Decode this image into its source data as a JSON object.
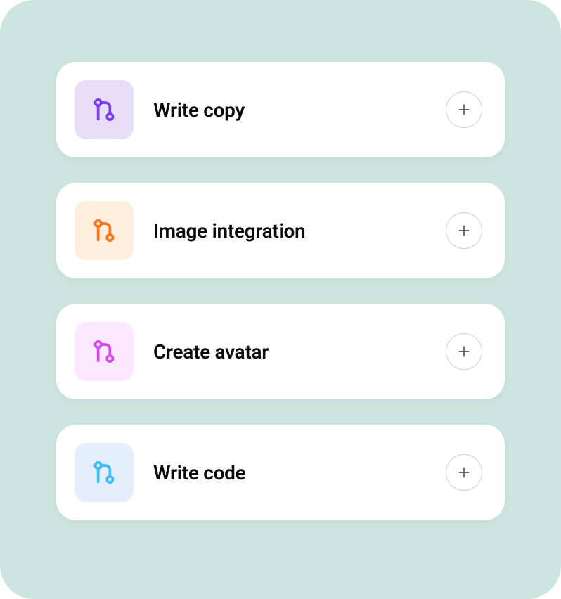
{
  "items": [
    {
      "label": "Write copy",
      "icon_bg": "#e8ddf7",
      "icon_color": "#7c3aed"
    },
    {
      "label": "Image integration",
      "icon_bg": "#fdeedd",
      "icon_color": "#f97316"
    },
    {
      "label": "Create avatar",
      "icon_bg": "#fae8fc",
      "icon_color": "#d946ef"
    },
    {
      "label": "Write code",
      "icon_bg": "#e4effa",
      "icon_color": "#38bdf8"
    }
  ]
}
